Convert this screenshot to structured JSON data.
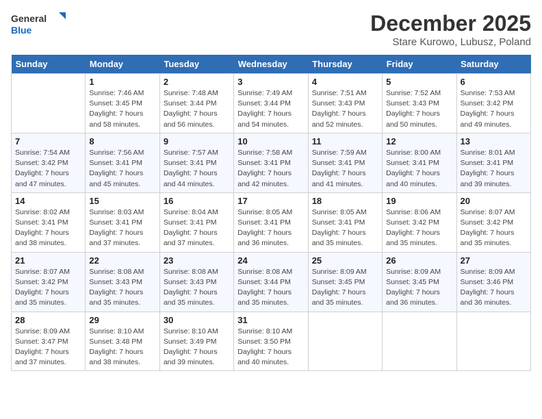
{
  "header": {
    "logo_general": "General",
    "logo_blue": "Blue",
    "month_title": "December 2025",
    "location": "Stare Kurowo, Lubusz, Poland"
  },
  "days_of_week": [
    "Sunday",
    "Monday",
    "Tuesday",
    "Wednesday",
    "Thursday",
    "Friday",
    "Saturday"
  ],
  "weeks": [
    [
      {
        "day": "",
        "info": ""
      },
      {
        "day": "1",
        "info": "Sunrise: 7:46 AM\nSunset: 3:45 PM\nDaylight: 7 hours\nand 58 minutes."
      },
      {
        "day": "2",
        "info": "Sunrise: 7:48 AM\nSunset: 3:44 PM\nDaylight: 7 hours\nand 56 minutes."
      },
      {
        "day": "3",
        "info": "Sunrise: 7:49 AM\nSunset: 3:44 PM\nDaylight: 7 hours\nand 54 minutes."
      },
      {
        "day": "4",
        "info": "Sunrise: 7:51 AM\nSunset: 3:43 PM\nDaylight: 7 hours\nand 52 minutes."
      },
      {
        "day": "5",
        "info": "Sunrise: 7:52 AM\nSunset: 3:43 PM\nDaylight: 7 hours\nand 50 minutes."
      },
      {
        "day": "6",
        "info": "Sunrise: 7:53 AM\nSunset: 3:42 PM\nDaylight: 7 hours\nand 49 minutes."
      }
    ],
    [
      {
        "day": "7",
        "info": "Sunrise: 7:54 AM\nSunset: 3:42 PM\nDaylight: 7 hours\nand 47 minutes."
      },
      {
        "day": "8",
        "info": "Sunrise: 7:56 AM\nSunset: 3:41 PM\nDaylight: 7 hours\nand 45 minutes."
      },
      {
        "day": "9",
        "info": "Sunrise: 7:57 AM\nSunset: 3:41 PM\nDaylight: 7 hours\nand 44 minutes."
      },
      {
        "day": "10",
        "info": "Sunrise: 7:58 AM\nSunset: 3:41 PM\nDaylight: 7 hours\nand 42 minutes."
      },
      {
        "day": "11",
        "info": "Sunrise: 7:59 AM\nSunset: 3:41 PM\nDaylight: 7 hours\nand 41 minutes."
      },
      {
        "day": "12",
        "info": "Sunrise: 8:00 AM\nSunset: 3:41 PM\nDaylight: 7 hours\nand 40 minutes."
      },
      {
        "day": "13",
        "info": "Sunrise: 8:01 AM\nSunset: 3:41 PM\nDaylight: 7 hours\nand 39 minutes."
      }
    ],
    [
      {
        "day": "14",
        "info": "Sunrise: 8:02 AM\nSunset: 3:41 PM\nDaylight: 7 hours\nand 38 minutes."
      },
      {
        "day": "15",
        "info": "Sunrise: 8:03 AM\nSunset: 3:41 PM\nDaylight: 7 hours\nand 37 minutes."
      },
      {
        "day": "16",
        "info": "Sunrise: 8:04 AM\nSunset: 3:41 PM\nDaylight: 7 hours\nand 37 minutes."
      },
      {
        "day": "17",
        "info": "Sunrise: 8:05 AM\nSunset: 3:41 PM\nDaylight: 7 hours\nand 36 minutes."
      },
      {
        "day": "18",
        "info": "Sunrise: 8:05 AM\nSunset: 3:41 PM\nDaylight: 7 hours\nand 35 minutes."
      },
      {
        "day": "19",
        "info": "Sunrise: 8:06 AM\nSunset: 3:42 PM\nDaylight: 7 hours\nand 35 minutes."
      },
      {
        "day": "20",
        "info": "Sunrise: 8:07 AM\nSunset: 3:42 PM\nDaylight: 7 hours\nand 35 minutes."
      }
    ],
    [
      {
        "day": "21",
        "info": "Sunrise: 8:07 AM\nSunset: 3:42 PM\nDaylight: 7 hours\nand 35 minutes."
      },
      {
        "day": "22",
        "info": "Sunrise: 8:08 AM\nSunset: 3:43 PM\nDaylight: 7 hours\nand 35 minutes."
      },
      {
        "day": "23",
        "info": "Sunrise: 8:08 AM\nSunset: 3:43 PM\nDaylight: 7 hours\nand 35 minutes."
      },
      {
        "day": "24",
        "info": "Sunrise: 8:08 AM\nSunset: 3:44 PM\nDaylight: 7 hours\nand 35 minutes."
      },
      {
        "day": "25",
        "info": "Sunrise: 8:09 AM\nSunset: 3:45 PM\nDaylight: 7 hours\nand 35 minutes."
      },
      {
        "day": "26",
        "info": "Sunrise: 8:09 AM\nSunset: 3:45 PM\nDaylight: 7 hours\nand 36 minutes."
      },
      {
        "day": "27",
        "info": "Sunrise: 8:09 AM\nSunset: 3:46 PM\nDaylight: 7 hours\nand 36 minutes."
      }
    ],
    [
      {
        "day": "28",
        "info": "Sunrise: 8:09 AM\nSunset: 3:47 PM\nDaylight: 7 hours\nand 37 minutes."
      },
      {
        "day": "29",
        "info": "Sunrise: 8:10 AM\nSunset: 3:48 PM\nDaylight: 7 hours\nand 38 minutes."
      },
      {
        "day": "30",
        "info": "Sunrise: 8:10 AM\nSunset: 3:49 PM\nDaylight: 7 hours\nand 39 minutes."
      },
      {
        "day": "31",
        "info": "Sunrise: 8:10 AM\nSunset: 3:50 PM\nDaylight: 7 hours\nand 40 minutes."
      },
      {
        "day": "",
        "info": ""
      },
      {
        "day": "",
        "info": ""
      },
      {
        "day": "",
        "info": ""
      }
    ]
  ]
}
